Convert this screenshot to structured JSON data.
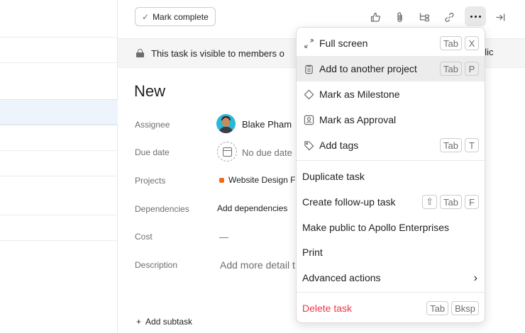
{
  "toolbar": {
    "mark_complete_label": "Mark complete",
    "icons": [
      "like-icon",
      "attachment-icon",
      "subtask-icon",
      "link-icon",
      "more-icon",
      "close-pane-icon"
    ]
  },
  "banner": {
    "text": "This task is visible to members o",
    "tail": "blic"
  },
  "task": {
    "title": "New",
    "fields": {
      "assignee_label": "Assignee",
      "assignee_value": "Blake Pham",
      "due_date_label": "Due date",
      "due_date_value": "No due date",
      "projects_label": "Projects",
      "projects_value": "Website Design F",
      "dependencies_label": "Dependencies",
      "dependencies_value": "Add dependencies",
      "cost_label": "Cost",
      "cost_value": "—",
      "description_label": "Description",
      "description_value": "Add more detail t"
    },
    "add_subtask": "Add subtask"
  },
  "menu": {
    "full_screen": {
      "label": "Full screen",
      "keys": [
        "Tab",
        "X"
      ],
      "icon": "expand-icon"
    },
    "add_to_project": {
      "label": "Add to another project",
      "keys": [
        "Tab",
        "P"
      ],
      "icon": "clipboard-icon"
    },
    "milestone": {
      "label": "Mark as Milestone",
      "icon": "diamond-icon"
    },
    "approval": {
      "label": "Mark as Approval",
      "icon": "approval-icon"
    },
    "add_tags": {
      "label": "Add tags",
      "keys": [
        "Tab",
        "T"
      ],
      "icon": "tag-icon"
    },
    "duplicate": {
      "label": "Duplicate task"
    },
    "follow_up": {
      "label": "Create follow-up task",
      "keys": [
        "⇧",
        "Tab",
        "F"
      ]
    },
    "make_public": {
      "label": "Make public to Apollo Enterprises"
    },
    "print": {
      "label": "Print"
    },
    "advanced": {
      "label": "Advanced actions"
    },
    "delete": {
      "label": "Delete task",
      "keys": [
        "Tab",
        "Bksp"
      ]
    }
  },
  "colors": {
    "danger": "#e8384f",
    "project_dot": "#f06a1c",
    "avatar_bg": "#2bb7d6",
    "highlight": "#ececed"
  }
}
